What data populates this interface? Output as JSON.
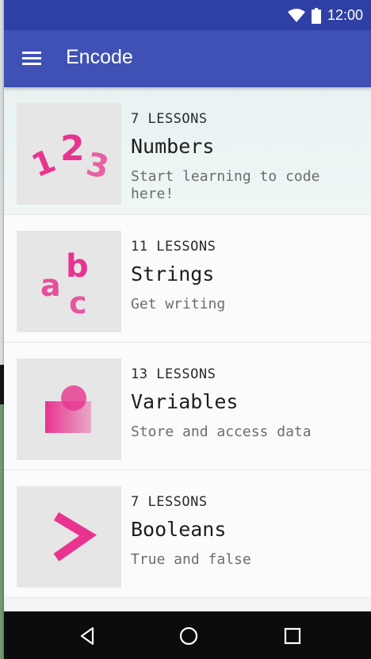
{
  "status_bar": {
    "time": "12:00",
    "icons": [
      "wifi-icon",
      "battery-icon"
    ]
  },
  "app_bar": {
    "title": "Encode",
    "menu_icon": "hamburger-menu-icon"
  },
  "lessons": [
    {
      "count": "7 LESSONS",
      "title": "Numbers",
      "description": "Start learning to code here!",
      "thumbnail_icon": "numbers-icon"
    },
    {
      "count": "11 LESSONS",
      "title": "Strings",
      "description": "Get writing",
      "thumbnail_icon": "strings-icon"
    },
    {
      "count": "13 LESSONS",
      "title": "Variables",
      "description": "Store and access data",
      "thumbnail_icon": "variables-icon"
    },
    {
      "count": "7 LESSONS",
      "title": "Booleans",
      "description": "True and false",
      "thumbnail_icon": "booleans-icon"
    }
  ],
  "nav_bar": {
    "buttons": [
      "back-icon",
      "home-icon",
      "recents-icon"
    ]
  },
  "colors": {
    "status_bar": "#2f40a5",
    "app_bar": "#3f51b5",
    "accent_pink": "#e8348f",
    "nav_bar": "#0c0c0c"
  }
}
